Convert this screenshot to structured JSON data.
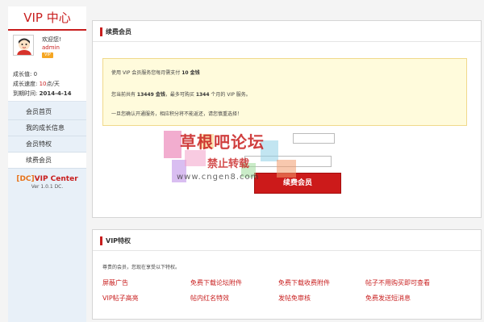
{
  "sidebar": {
    "title": "VIP 中心",
    "welcome": "欢迎您!",
    "username": "admin",
    "vip_badge": "VIP",
    "growth_value_label": "成长值: ",
    "growth_value": "0",
    "growth_speed_label": "成长速度: ",
    "growth_speed": "10",
    "growth_speed_unit": "点/天",
    "expire_label": "到期时间: ",
    "expire_date": "2014-4-14",
    "menu": [
      {
        "label": "会员首页",
        "active": false
      },
      {
        "label": "我的成长信息",
        "active": false
      },
      {
        "label": "会员特权",
        "active": false
      },
      {
        "label": "续费会员",
        "active": true
      }
    ],
    "brand_prefix": "[DC]",
    "brand_name": "VIP Center",
    "version": "Ver 1.0.1 DC."
  },
  "renew": {
    "title": "续费会员",
    "notice": {
      "line1_pre": "使用 VIP 会员服务您每月需支付 ",
      "line1_amount": "10 金钱",
      "line2_pre": "您当前共有 ",
      "line2_balance": "13449 金钱",
      "line2_mid": "，最多可购买 ",
      "line2_months": "1344",
      "line2_post": " 个月的 VIP 服务。",
      "line3": "一旦您确认开通服务，相应积分将不能返还，请您慎重选择！"
    },
    "button_label": "续费会员"
  },
  "watermark": {
    "line1": "草根吧论坛",
    "line2": "禁止转载",
    "url": "www.cngen8.com"
  },
  "privileges": {
    "title": "VIP特权",
    "intro": "尊贵的会员，您现在享受以下特权。",
    "items": [
      "屏蔽广告",
      "免费下载论坛附件",
      "免费下载收费附件",
      "帖子不用购买即可查看",
      "VIP帖子高亮",
      "帖内红名特效",
      "发帖免审核",
      "免费发送短消息"
    ]
  },
  "colors": {
    "accent_red": "#c81e1e",
    "notice_bg": "#fffbdc",
    "sidebar_bg": "#e8f0f8",
    "badge_orange": "#f5a623"
  }
}
